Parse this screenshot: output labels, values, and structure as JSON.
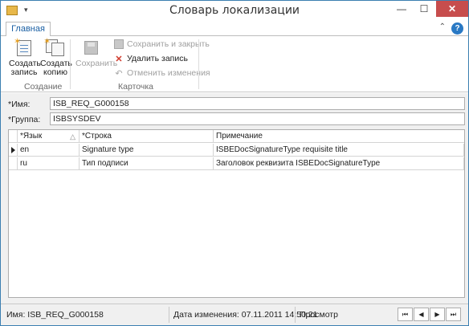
{
  "window": {
    "title": "Словарь локализации",
    "controls": {
      "minimize": "—",
      "maximize": "☐",
      "close": "✕"
    },
    "qat_arrow": "▾"
  },
  "ribbon": {
    "tab": "Главная",
    "help": "?",
    "collapse": "⌃",
    "groups": {
      "create": {
        "label": "Создание",
        "create_line1": "Создать",
        "create_line2": "запись",
        "copy_line1": "Создать",
        "copy_line2": "копию"
      },
      "card": {
        "label": "Карточка",
        "save": "Сохранить",
        "save_close": "Сохранить и закрыть",
        "delete": "Удалить запись",
        "cancel": "Отменить изменения"
      }
    }
  },
  "form": {
    "name_label": "*Имя:",
    "name_value": "ISB_REQ_G000158",
    "group_label": "*Группа:",
    "group_value": "ISBSYSDEV"
  },
  "grid": {
    "columns": [
      "*Язык",
      "*Строка",
      "Примечание"
    ],
    "sort_indicator": "△",
    "rows": [
      {
        "lang": "en",
        "string": "Signature type",
        "note": "ISBEDocSignatureType requisite title"
      },
      {
        "lang": "ru",
        "string": "Тип подписи",
        "note": "Заголовок реквизита ISBEDocSignatureType"
      }
    ]
  },
  "status": {
    "name": "Имя: ISB_REQ_G000158",
    "modified": "Дата изменения: 07.11.2011 14:50:21",
    "mode": "Просмотр",
    "nav": {
      "first": "⏮",
      "prev": "◀",
      "next": "▶",
      "last": "⏭"
    }
  },
  "colors": {
    "accent": "#2a79c4",
    "tab_text": "#1a5fa3",
    "close_button": "#c74d4d",
    "delete_icon": "#d03a2c",
    "window_border": "#3c7fb1"
  }
}
